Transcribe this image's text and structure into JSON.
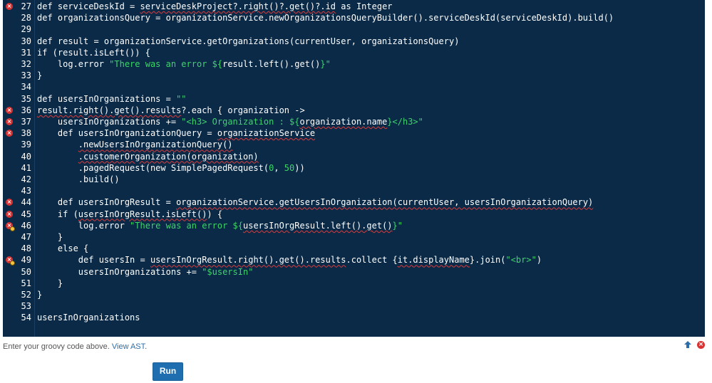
{
  "editor": {
    "lines": [
      {
        "num": "27",
        "error": true,
        "warn": false,
        "segments": [
          {
            "t": "def serviceDeskId = "
          },
          {
            "t": "serviceDeskProject?.right()?.get()?.id",
            "e": true
          },
          {
            "t": " as Integer"
          }
        ]
      },
      {
        "num": "28",
        "error": false,
        "warn": false,
        "segments": [
          {
            "t": "def organizationsQuery = organizationService.newOrganizationsQueryBuilder().serviceDeskId(serviceDeskId).build()"
          }
        ]
      },
      {
        "num": "29",
        "error": false,
        "warn": false,
        "segments": [
          {
            "t": ""
          }
        ]
      },
      {
        "num": "30",
        "error": false,
        "warn": false,
        "segments": [
          {
            "t": "def result = organizationService.getOrganizations(currentUser, organizationsQuery)"
          }
        ]
      },
      {
        "num": "31",
        "error": false,
        "warn": false,
        "segments": [
          {
            "t": "if (result.isLeft()) {"
          }
        ]
      },
      {
        "num": "32",
        "error": false,
        "warn": false,
        "segments": [
          {
            "t": "    log.error "
          },
          {
            "t": "\"There was an error ${",
            "s": true
          },
          {
            "t": "result.left().get()"
          },
          {
            "t": "}\"",
            "s": true
          }
        ]
      },
      {
        "num": "33",
        "error": false,
        "warn": false,
        "segments": [
          {
            "t": "}"
          }
        ]
      },
      {
        "num": "34",
        "error": false,
        "warn": false,
        "segments": [
          {
            "t": ""
          }
        ]
      },
      {
        "num": "35",
        "error": false,
        "warn": false,
        "segments": [
          {
            "t": "def usersInOrganizations = "
          },
          {
            "t": "\"\"",
            "s": true
          }
        ]
      },
      {
        "num": "36",
        "error": true,
        "warn": false,
        "segments": [
          {
            "t": "result.right().get().results",
            "e": true
          },
          {
            "t": "?.each { organization ->"
          }
        ]
      },
      {
        "num": "37",
        "error": true,
        "warn": false,
        "segments": [
          {
            "t": "    usersInOrganizations += "
          },
          {
            "t": "\"<h3> Organization : ${",
            "s": true
          },
          {
            "t": "organization.name",
            "e": true
          },
          {
            "t": "}</h3>\"",
            "s": true
          }
        ]
      },
      {
        "num": "38",
        "error": true,
        "warn": false,
        "segments": [
          {
            "t": "    def usersInOrganizationQuery = "
          },
          {
            "t": "organizationService",
            "e": true
          }
        ]
      },
      {
        "num": "39",
        "error": false,
        "warn": false,
        "segments": [
          {
            "t": "        "
          },
          {
            "t": ".newUsersInOrganizationQuery()",
            "e": true
          }
        ]
      },
      {
        "num": "40",
        "error": false,
        "warn": false,
        "segments": [
          {
            "t": "        "
          },
          {
            "t": ".customerOrganization(organization)",
            "e": true
          }
        ]
      },
      {
        "num": "41",
        "error": false,
        "warn": false,
        "segments": [
          {
            "t": "        .pagedRequest(new SimplePagedRequest("
          },
          {
            "t": "0",
            "s": true
          },
          {
            "t": ", "
          },
          {
            "t": "50",
            "s": true
          },
          {
            "t": "))"
          }
        ]
      },
      {
        "num": "42",
        "error": false,
        "warn": false,
        "segments": [
          {
            "t": "        .build()"
          }
        ]
      },
      {
        "num": "43",
        "error": false,
        "warn": false,
        "segments": [
          {
            "t": ""
          }
        ]
      },
      {
        "num": "44",
        "error": true,
        "warn": false,
        "segments": [
          {
            "t": "    def usersInOrgResult = "
          },
          {
            "t": "organizationService.getUsersInOrganization(currentUser, usersInOrganizationQuery)",
            "e": true
          }
        ]
      },
      {
        "num": "45",
        "error": true,
        "warn": false,
        "segments": [
          {
            "t": "    if ("
          },
          {
            "t": "usersInOrgResult.isLeft()",
            "e": true
          },
          {
            "t": ") {"
          }
        ]
      },
      {
        "num": "46",
        "error": true,
        "warn": true,
        "segments": [
          {
            "t": "        log.error "
          },
          {
            "t": "\"There was an error ${",
            "s": true
          },
          {
            "t": "usersInOrgResult.left().get()",
            "e": true
          },
          {
            "t": "}\"",
            "s": true
          }
        ]
      },
      {
        "num": "47",
        "error": false,
        "warn": false,
        "segments": [
          {
            "t": "    }"
          }
        ]
      },
      {
        "num": "48",
        "error": false,
        "warn": false,
        "segments": [
          {
            "t": "    else {"
          }
        ]
      },
      {
        "num": "49",
        "error": true,
        "warn": true,
        "segments": [
          {
            "t": "        def usersIn = "
          },
          {
            "t": "usersInOrgResult.right().get().results",
            "e": true
          },
          {
            "t": ".collect {"
          },
          {
            "t": "it.displayName",
            "e": true
          },
          {
            "t": "}.join("
          },
          {
            "t": "\"<br>\"",
            "s": true
          },
          {
            "t": ")"
          }
        ]
      },
      {
        "num": "50",
        "error": false,
        "warn": false,
        "segments": [
          {
            "t": "        usersInOrganizations += "
          },
          {
            "t": "\"$usersIn\"",
            "s": true
          }
        ]
      },
      {
        "num": "51",
        "error": false,
        "warn": false,
        "segments": [
          {
            "t": "    }"
          }
        ]
      },
      {
        "num": "52",
        "error": false,
        "warn": false,
        "segments": [
          {
            "t": "}"
          }
        ]
      },
      {
        "num": "53",
        "error": false,
        "warn": false,
        "segments": [
          {
            "t": ""
          }
        ]
      },
      {
        "num": "54",
        "error": false,
        "warn": false,
        "segments": [
          {
            "t": "usersInOrganizations"
          }
        ]
      }
    ]
  },
  "footer": {
    "hint": "Enter your groovy code above. ",
    "ast_link": "View AST",
    "hint_end": "."
  },
  "icons": {
    "scroll_up": "scroll-to-top-icon",
    "close": "close-icon",
    "error_marker": "error-marker-icon"
  },
  "colors": {
    "editor_bg": "#0a2a47",
    "string": "#3ed46a",
    "error": "#d93333",
    "run_button": "#1f6fb0"
  },
  "run_button": {
    "label": "Run"
  }
}
